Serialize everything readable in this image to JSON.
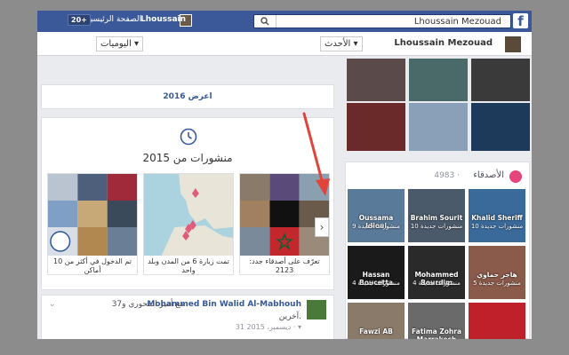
{
  "topbar": {
    "user_name": "Lhoussain Mezouad",
    "search_placeholder": "Lhoussain Mezouad",
    "short_name": "Lhoussain",
    "home_label": "الصفحة الرئيسية",
    "badge_count": "20+",
    "logo": "f"
  },
  "timeline_nav": {
    "profile_name": "Lhoussain Mezouad",
    "timeline_label": "اليوميات ▾",
    "latest_label": "الأحدث ▾"
  },
  "feed": {
    "show_year_label": "اعرض 2016",
    "year_title": "منشورات من 2015",
    "cards": [
      {
        "text": "تم الدخول في أكثر من 10 أماكن"
      },
      {
        "text": "تمت زيارة 6 من المدن وبلد واحد"
      },
      {
        "text": "تعرّف على أصدقاء جدد: 2123"
      }
    ],
    "next_arrow": "›"
  },
  "post": {
    "author": "Mohammed Bin Walid Al-Mabhouh",
    "with_text": "مع أمير المحوري و37",
    "others_text": "آخرين.",
    "date": "31 ديسمبر، 2015 · ▾"
  },
  "friends": {
    "title": "الأصدقاء",
    "count": "4983 ·",
    "items": [
      {
        "name": "Khalid Sheriff",
        "sub": "10 منشورات جديدة"
      },
      {
        "name": "Brahim Sourit",
        "sub": "10 منشورات جديدة"
      },
      {
        "name": "Oussama Idioui",
        "sub": "9 منشورات جديدة"
      },
      {
        "name": "هاجر حماوي",
        "sub": "5 منشورات جديدة"
      },
      {
        "name": "Mohammed Bourdim",
        "sub": "4 منشورات جديدة"
      },
      {
        "name": "Hassan Boucetta",
        "sub": "4 منشورات جديدة"
      },
      {
        "name": "",
        "sub": ""
      },
      {
        "name": "Fatima Zohra Marrakech",
        "sub": ""
      },
      {
        "name": "Fawzi AB",
        "sub": ""
      }
    ]
  },
  "colors": {
    "brand": "#3b5998",
    "link": "#365899",
    "friends_icon": "#e4457b",
    "annotation": "#e0443a"
  }
}
